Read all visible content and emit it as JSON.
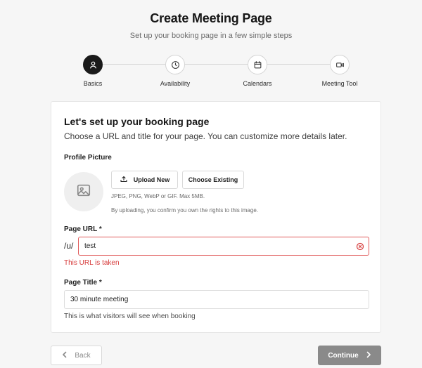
{
  "header": {
    "title": "Create Meeting Page",
    "subtitle": "Set up your booking page in a few simple steps"
  },
  "steps": [
    {
      "label": "Basics",
      "icon": "user-icon",
      "active": true
    },
    {
      "label": "Availability",
      "icon": "clock-icon",
      "active": false
    },
    {
      "label": "Calendars",
      "icon": "calendar-icon",
      "active": false
    },
    {
      "label": "Meeting Tool",
      "icon": "video-icon",
      "active": false
    }
  ],
  "card": {
    "title": "Let's set up your booking page",
    "description": "Choose a URL and title for your page. You can customize more details later."
  },
  "profile": {
    "label": "Profile Picture",
    "upload_label": "Upload New",
    "choose_label": "Choose Existing",
    "formats_note": "JPEG, PNG, WebP or GIF. Max 5MB.",
    "rights_note": "By uploading, you confirm you own the rights to this image."
  },
  "page_url": {
    "label": "Page URL *",
    "prefix": "/u/",
    "value": "test",
    "error": "This URL is taken"
  },
  "page_title": {
    "label": "Page Title *",
    "value": "30 minute meeting",
    "helper": "This is what visitors will see when booking"
  },
  "footer": {
    "back_label": "Back",
    "continue_label": "Continue"
  },
  "colors": {
    "accent_active": "#1a1a1a",
    "error": "#d63a3a",
    "continue_bg": "#8a8a8a"
  }
}
